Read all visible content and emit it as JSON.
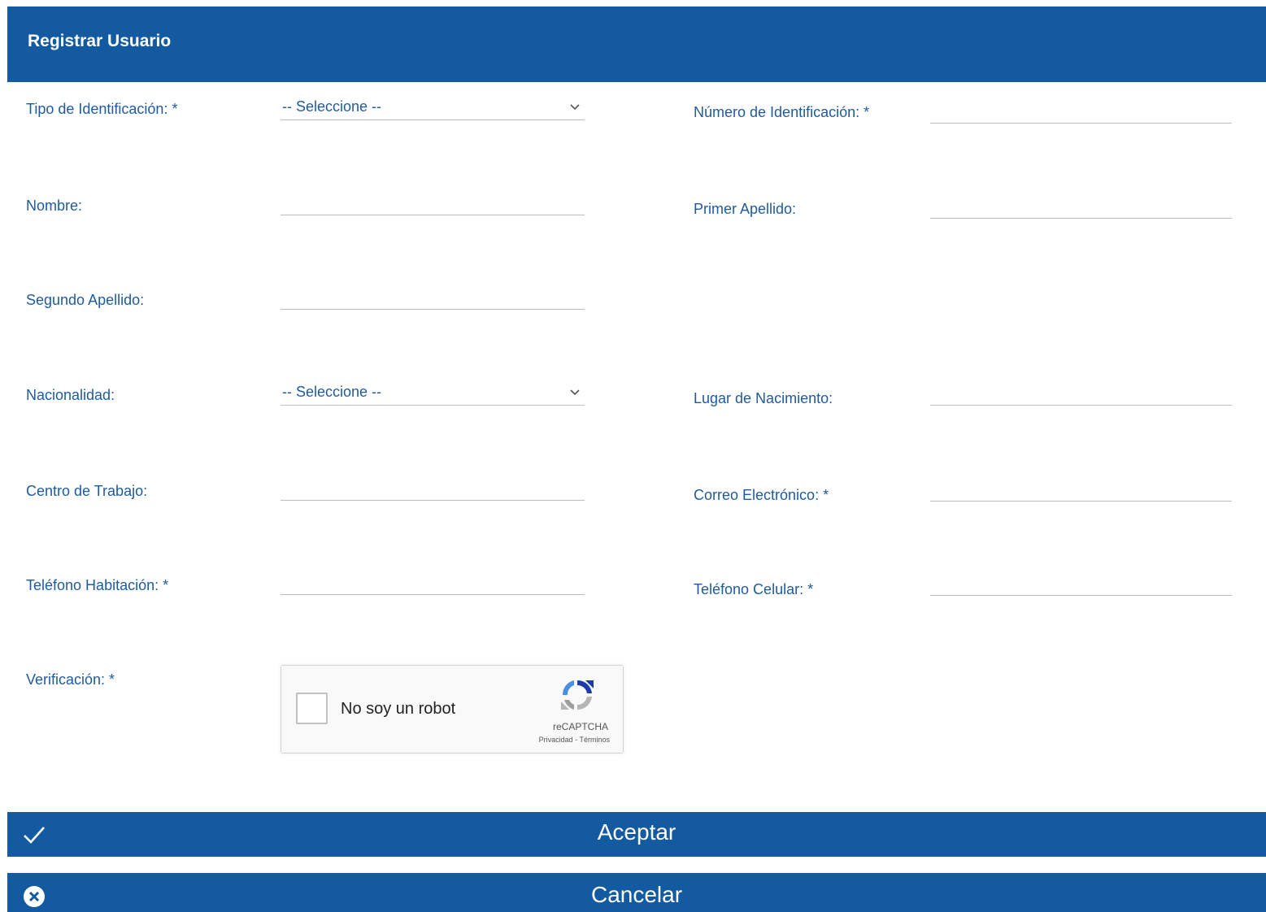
{
  "header": {
    "title": "Registrar Usuario"
  },
  "form": {
    "tipo_identificacion": {
      "label": "Tipo de Identificación: *",
      "value": "-- Seleccione --"
    },
    "numero_identificacion": {
      "label": "Número de Identificación: *",
      "value": ""
    },
    "nombre": {
      "label": "Nombre:",
      "value": ""
    },
    "primer_apellido": {
      "label": "Primer Apellido:",
      "value": ""
    },
    "segundo_apellido": {
      "label": "Segundo Apellido:",
      "value": ""
    },
    "nacionalidad": {
      "label": "Nacionalidad:",
      "value": "-- Seleccione --"
    },
    "lugar_nacimiento": {
      "label": "Lugar de Nacimiento:",
      "value": ""
    },
    "centro_trabajo": {
      "label": "Centro de Trabajo:",
      "value": ""
    },
    "correo": {
      "label": "Correo Electrónico: *",
      "value": ""
    },
    "telefono_habitacion": {
      "label": "Teléfono Habitación: *",
      "value": ""
    },
    "telefono_celular": {
      "label": "Teléfono Celular: *",
      "value": ""
    },
    "verificacion": {
      "label": "Verificación: *"
    }
  },
  "captcha": {
    "text": "No soy un robot",
    "brand": "reCAPTCHA",
    "links": "Privacidad - Términos"
  },
  "buttons": {
    "accept": "Aceptar",
    "cancel": "Cancelar"
  },
  "colors": {
    "primary": "#145aa0",
    "label": "#1f5b9c"
  },
  "icons": {
    "dropdown": "chevron-down-icon",
    "accept": "checkmark-icon",
    "cancel": "close-circle-icon",
    "captcha": "recaptcha-logo-icon"
  }
}
